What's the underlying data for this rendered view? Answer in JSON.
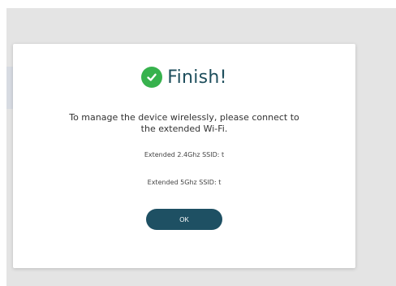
{
  "dialog": {
    "title": "Finish!",
    "message": "To manage the device wirelessly, please connect to the extended Wi-Fi.",
    "ssid_24": "Extended 2.4Ghz SSID: t",
    "ssid_5": "Extended 5Ghz SSID: t",
    "ok_label": "OK",
    "check_icon": "check-circle-icon"
  },
  "colors": {
    "accent": "#1e5063",
    "success": "#37b24d"
  }
}
